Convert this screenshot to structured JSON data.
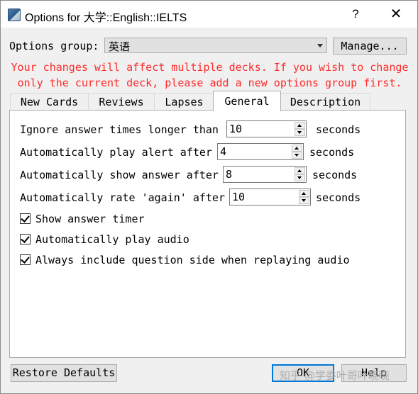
{
  "window": {
    "title": "Options for 大学::English::IELTS",
    "help_label": "?",
    "close_label": "✕"
  },
  "options_group": {
    "label": "Options group:",
    "value": "英语",
    "manage_label": "Manage..."
  },
  "warning": {
    "line1": "Your changes will affect multiple decks. If you wish to change",
    "line2": "only the current deck, please add a new options group first.",
    "color": "#ff2a2a"
  },
  "tabs": [
    {
      "label": "New Cards"
    },
    {
      "label": "Reviews"
    },
    {
      "label": "Lapses"
    },
    {
      "label": "General"
    },
    {
      "label": "Description"
    }
  ],
  "active_tab": "General",
  "general": {
    "rows": [
      {
        "label": "Ignore answer times longer than",
        "value": "10",
        "unit": "seconds"
      },
      {
        "label": "Automatically play alert after",
        "value": "4",
        "unit": "seconds"
      },
      {
        "label": "Automatically show answer after",
        "value": "8",
        "unit": "seconds"
      },
      {
        "label": "Automatically rate 'again' after",
        "value": "10",
        "unit": "seconds"
      }
    ],
    "checkboxes": [
      {
        "label": "Show answer timer",
        "checked": true
      },
      {
        "label": "Automatically play audio",
        "checked": true
      },
      {
        "label": "Always include question side when replaying audio",
        "checked": true
      }
    ]
  },
  "footer": {
    "restore_label": "Restore Defaults",
    "ok_label": "OK",
    "help_label": "Help",
    "watermark": "知乎 @学委叶哥叶晓晓"
  }
}
